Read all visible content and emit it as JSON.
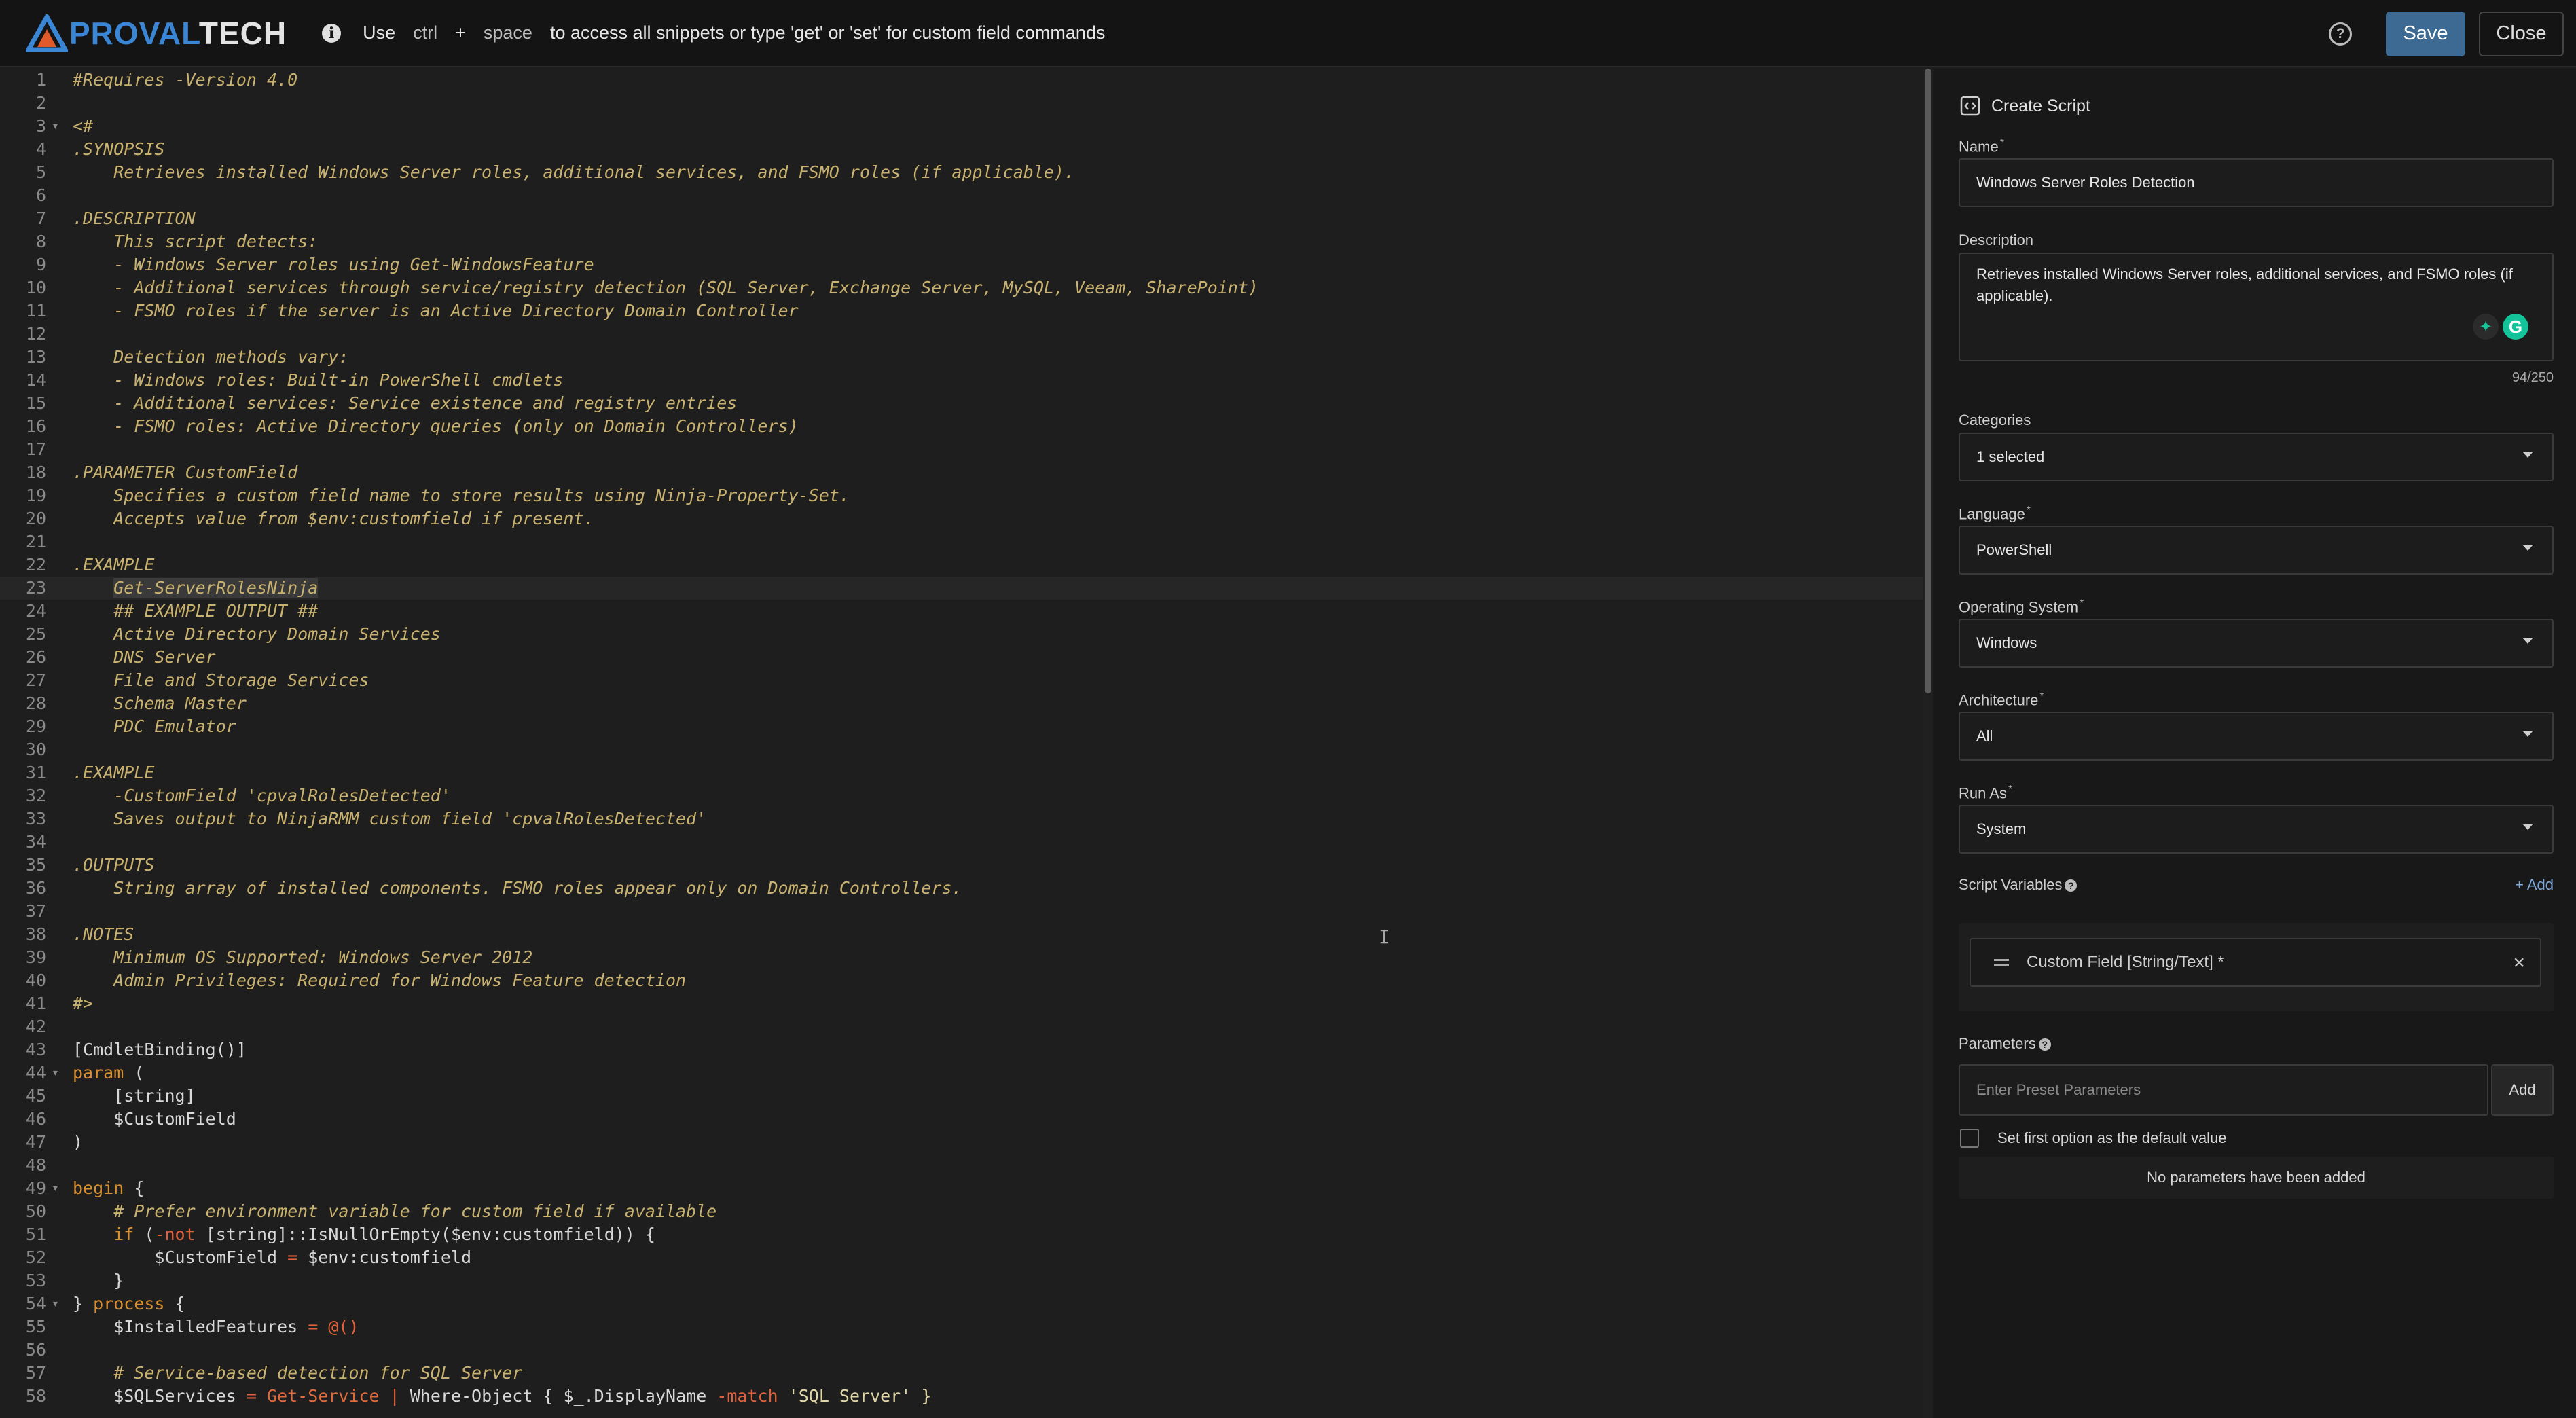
{
  "header": {
    "logo_pro": "PROVAL",
    "logo_tech": "TECH",
    "hint_use": "Use",
    "hint_ctrl": "ctrl",
    "hint_plus": "+",
    "hint_space": "space",
    "hint_text": "to access all snippets or type 'get' or 'set' for custom field commands",
    "save_label": "Save",
    "close_label": "Close"
  },
  "editor": {
    "lines": [
      [
        {
          "t": "#Requires -Version 4.0",
          "c": "c-cm"
        }
      ],
      [],
      [
        {
          "t": "<#",
          "c": "c-cm"
        }
      ],
      [
        {
          "t": ".SYNOPSIS",
          "c": "c-cm"
        }
      ],
      [
        {
          "t": "    Retrieves installed Windows Server roles, additional services, and FSMO roles (if applicable).",
          "c": "c-cm"
        }
      ],
      [],
      [
        {
          "t": ".DESCRIPTION",
          "c": "c-cm"
        }
      ],
      [
        {
          "t": "    This script detects:",
          "c": "c-cm"
        }
      ],
      [
        {
          "t": "    - Windows Server roles using Get-WindowsFeature",
          "c": "c-cm"
        }
      ],
      [
        {
          "t": "    - Additional services through service/registry detection (SQL Server, Exchange Server, MySQL, Veeam, SharePoint)",
          "c": "c-cm"
        }
      ],
      [
        {
          "t": "    - FSMO roles if the server is an Active Directory Domain Controller",
          "c": "c-cm"
        }
      ],
      [],
      [
        {
          "t": "    Detection methods vary:",
          "c": "c-cm"
        }
      ],
      [
        {
          "t": "    - Windows roles: Built-in PowerShell cmdlets",
          "c": "c-cm"
        }
      ],
      [
        {
          "t": "    - Additional services: Service existence and registry entries",
          "c": "c-cm"
        }
      ],
      [
        {
          "t": "    - FSMO roles: Active Directory queries (only on Domain Controllers)",
          "c": "c-cm"
        }
      ],
      [],
      [
        {
          "t": ".PARAMETER CustomField",
          "c": "c-cm"
        }
      ],
      [
        {
          "t": "    Specifies a custom field name to store results using Ninja-Property-Set.",
          "c": "c-cm"
        }
      ],
      [
        {
          "t": "    Accepts value from $env:customfield if present.",
          "c": "c-cm"
        }
      ],
      [],
      [
        {
          "t": ".EXAMPLE",
          "c": "c-cm"
        }
      ],
      [
        {
          "t": "    ",
          "c": "c-cm"
        },
        {
          "t": "Get-ServerRolesNinja",
          "c": "c-cm c-sel"
        }
      ],
      [
        {
          "t": "    ## EXAMPLE OUTPUT ##",
          "c": "c-cm"
        }
      ],
      [
        {
          "t": "    Active Directory Domain Services",
          "c": "c-cm"
        }
      ],
      [
        {
          "t": "    DNS Server",
          "c": "c-cm"
        }
      ],
      [
        {
          "t": "    File and Storage Services",
          "c": "c-cm"
        }
      ],
      [
        {
          "t": "    Schema Master",
          "c": "c-cm"
        }
      ],
      [
        {
          "t": "    PDC Emulator",
          "c": "c-cm"
        }
      ],
      [],
      [
        {
          "t": ".EXAMPLE",
          "c": "c-cm"
        }
      ],
      [
        {
          "t": "    -CustomField 'cpvalRolesDetected'",
          "c": "c-cm"
        }
      ],
      [
        {
          "t": "    Saves output to NinjaRMM custom field 'cpvalRolesDetected'",
          "c": "c-cm"
        }
      ],
      [],
      [
        {
          "t": ".OUTPUTS",
          "c": "c-cm"
        }
      ],
      [
        {
          "t": "    String array of installed components. FSMO roles appear only on Domain Controllers.",
          "c": "c-cm"
        }
      ],
      [],
      [
        {
          "t": ".NOTES",
          "c": "c-cm"
        }
      ],
      [
        {
          "t": "    Minimum OS Supported: Windows Server 2012",
          "c": "c-cm"
        }
      ],
      [
        {
          "t": "    Admin Privileges: Required for Windows Feature detection",
          "c": "c-cm"
        }
      ],
      [
        {
          "t": "#>",
          "c": "c-cm"
        }
      ],
      [],
      [
        {
          "t": "[CmdletBinding()]",
          "c": "c-tx"
        }
      ],
      [
        {
          "t": "param",
          "c": "c-kw"
        },
        {
          "t": " (",
          "c": "c-tx"
        }
      ],
      [
        {
          "t": "    [string]",
          "c": "c-tx"
        }
      ],
      [
        {
          "t": "    $CustomField",
          "c": "c-tx"
        }
      ],
      [
        {
          "t": ")",
          "c": "c-tx"
        }
      ],
      [],
      [
        {
          "t": "begin",
          "c": "c-kw"
        },
        {
          "t": " {",
          "c": "c-tx"
        }
      ],
      [
        {
          "t": "    # Prefer environment variable for custom field if available",
          "c": "c-cm"
        }
      ],
      [
        {
          "t": "    ",
          "c": "c-tx"
        },
        {
          "t": "if",
          "c": "c-kw"
        },
        {
          "t": " (",
          "c": "c-tx"
        },
        {
          "t": "-not",
          "c": "c-op"
        },
        {
          "t": " [string]::IsNullOrEmpty($env:customfield)) {",
          "c": "c-tx"
        }
      ],
      [
        {
          "t": "        $CustomField ",
          "c": "c-tx"
        },
        {
          "t": "=",
          "c": "c-op"
        },
        {
          "t": " $env:customfield",
          "c": "c-tx"
        }
      ],
      [
        {
          "t": "    }",
          "c": "c-tx"
        }
      ],
      [
        {
          "t": "} ",
          "c": "c-tx"
        },
        {
          "t": "process",
          "c": "c-kw"
        },
        {
          "t": " {",
          "c": "c-tx"
        }
      ],
      [
        {
          "t": "    $InstalledFeatures ",
          "c": "c-tx"
        },
        {
          "t": "= @()",
          "c": "c-op"
        }
      ],
      [],
      [
        {
          "t": "    # Service-based detection for SQL Server",
          "c": "c-cm"
        }
      ],
      [
        {
          "t": "    $SQLServices ",
          "c": "c-tx"
        },
        {
          "t": "=",
          "c": "c-op"
        },
        {
          "t": " ",
          "c": "c-tx"
        },
        {
          "t": "Get-Service",
          "c": "c-fn"
        },
        {
          "t": " ",
          "c": "c-tx"
        },
        {
          "t": "|",
          "c": "c-op"
        },
        {
          "t": " Where-Object { $_.DisplayName ",
          "c": "c-tx"
        },
        {
          "t": "-match",
          "c": "c-op"
        },
        {
          "t": " 'SQL Server' }",
          "c": "c-str"
        }
      ]
    ]
  },
  "panel": {
    "title": "Create Script",
    "name_label": "Name",
    "name_value": "Windows Server Roles Detection",
    "description_label": "Description",
    "description_value": "Retrieves installed Windows Server roles, additional services, and FSMO roles (if applicable).",
    "description_counter": "94/250",
    "categories_label": "Categories",
    "categories_value": "1 selected",
    "language_label": "Language",
    "language_value": "PowerShell",
    "os_label": "Operating System",
    "os_value": "Windows",
    "arch_label": "Architecture",
    "arch_value": "All",
    "runas_label": "Run As",
    "runas_value": "System",
    "script_vars_label": "Script Variables",
    "script_vars_add": "+ Add",
    "variable_chip": "Custom Field [String/Text] *",
    "parameters_label": "Parameters",
    "parameters_placeholder": "Enter Preset Parameters",
    "parameters_add": "Add",
    "default_checkbox_label": "Set first option as the default value",
    "no_params_text": "No parameters have been added",
    "required_mark": "*"
  }
}
